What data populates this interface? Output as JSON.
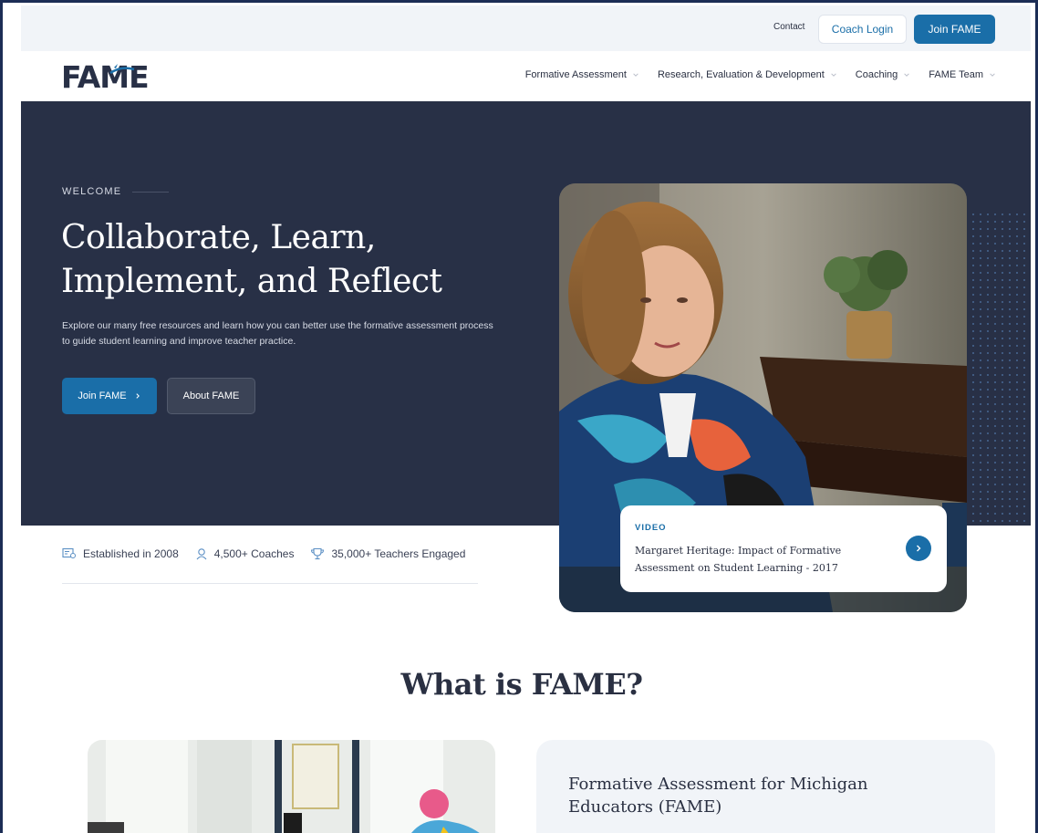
{
  "header": {
    "contact": "Contact",
    "coach_login": "Coach Login",
    "join": "Join FAME"
  },
  "logo": {
    "text": "FAME"
  },
  "nav": {
    "items": [
      {
        "label": "Formative Assessment"
      },
      {
        "label": "Research, Evaluation & Development"
      },
      {
        "label": "Coaching"
      },
      {
        "label": "FAME Team"
      }
    ]
  },
  "hero": {
    "eyebrow": "WELCOME",
    "title": "Collaborate, Learn, Implement, and Reflect",
    "text": "Explore our many free resources and learn how you can better use the formative assessment process to guide student learning and improve teacher practice.",
    "join_button": "Join FAME",
    "about_button": "About FAME"
  },
  "stats": [
    {
      "label": "Established in 2008",
      "icon": "certificate-icon"
    },
    {
      "label": "4,500+ Coaches",
      "icon": "user-icon"
    },
    {
      "label": "35,000+ Teachers Engaged",
      "icon": "trophy-icon"
    }
  ],
  "video": {
    "tag": "VIDEO",
    "title": "Margaret Heritage: Impact of Formative Assessment on Student Learning - 2017"
  },
  "section": {
    "title": "What is FAME?",
    "card_title": "Formative Assessment for Michigan Educators (FAME)"
  },
  "colors": {
    "brand_blue": "#1a6ea8",
    "navy": "#283046",
    "light_bg": "#f1f4f8"
  }
}
